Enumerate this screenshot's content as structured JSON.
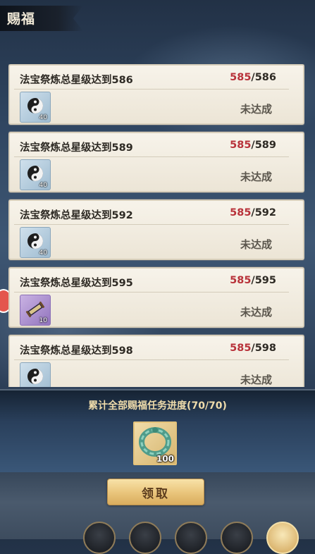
{
  "header": {
    "title": "赐福"
  },
  "tasks": [
    {
      "title": "法宝祭炼总星级达到586",
      "current": "585",
      "target": "/586",
      "status": "未达成",
      "reward_icon": "yin-yang-orb-icon",
      "reward_count": "40"
    },
    {
      "title": "法宝祭炼总星级达到589",
      "current": "585",
      "target": "/589",
      "status": "未达成",
      "reward_icon": "yin-yang-orb-icon",
      "reward_count": "40"
    },
    {
      "title": "法宝祭炼总星级达到592",
      "current": "585",
      "target": "/592",
      "status": "未达成",
      "reward_icon": "yin-yang-orb-icon",
      "reward_count": "40"
    },
    {
      "title": "法宝祭炼总星级达到595",
      "current": "585",
      "target": "/595",
      "status": "未达成",
      "reward_icon": "scroll-item-icon",
      "reward_count": "10"
    },
    {
      "title": "法宝祭炼总星级达到598",
      "current": "585",
      "target": "/598",
      "status": "未达成",
      "reward_icon": "yin-yang-orb-icon",
      "reward_count": ""
    }
  ],
  "summary": {
    "title": "累计全部赐福任务进度(70/70)",
    "reward_icon": "jade-ring-icon",
    "reward_count": "100",
    "claim_label": "领取"
  },
  "colors": {
    "progress_current": "#b8323a",
    "panel_title": "#efdcab",
    "button_gold": "#e9c47a"
  }
}
